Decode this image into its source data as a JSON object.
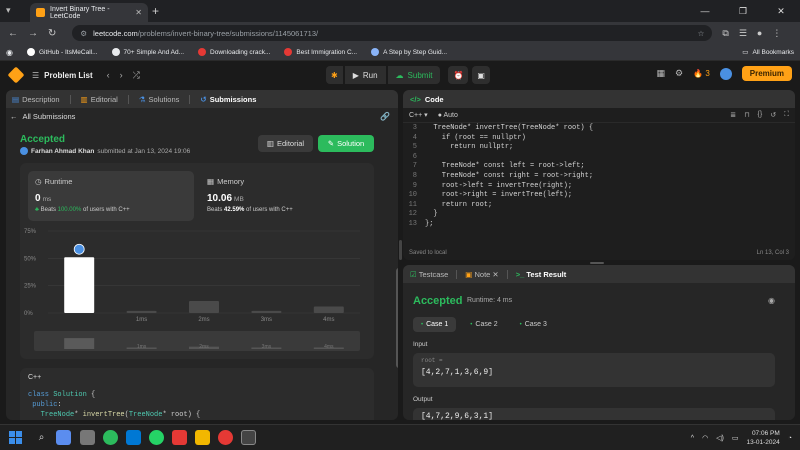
{
  "browser": {
    "tab_title": "Invert Binary Tree - LeetCode",
    "url_host": "leetcode.com",
    "url_path": "/problems/invert-binary-tree/submissions/1145061713/",
    "bookmarks": [
      {
        "label": "GitHub - ItsMeCall...",
        "color": "#ffffff"
      },
      {
        "label": "70+ Simple And Ad...",
        "color": "#e8eaed"
      },
      {
        "label": "Downloading crack...",
        "color": "#e53935"
      },
      {
        "label": "Best Immigration C...",
        "color": "#e53935"
      },
      {
        "label": "A Step by Step Guid...",
        "color": "#8ab4f8"
      }
    ],
    "all_bookmarks": "All Bookmarks"
  },
  "lc": {
    "problem_list": "Problem List",
    "run": "Run",
    "submit": "Submit",
    "streak": "3",
    "premium": "Premium"
  },
  "left": {
    "tabs": [
      "Description",
      "Editorial",
      "Solutions",
      "Submissions"
    ],
    "all_submissions": "All Submissions",
    "status": "Accepted",
    "user": "Farhan Ahmad Khan",
    "submitted_text": "submitted at Jan 13, 2024 19:06",
    "editorial_btn": "Editorial",
    "solution_btn": "Solution",
    "runtime": {
      "label": "Runtime",
      "value": "0",
      "unit": "ms",
      "beats_prefix": "Beats",
      "beats_pct": "100.00%",
      "beats_suffix": "of users with C++"
    },
    "memory": {
      "label": "Memory",
      "value": "10.06",
      "unit": "MB",
      "beats_prefix": "Beats",
      "beats_pct": "42.59%",
      "beats_suffix": "of users with C++"
    },
    "code_lang": "C++",
    "code_lines": [
      "class Solution {",
      " public:",
      "   TreeNode* invertTree(TreeNode* root) {"
    ]
  },
  "chart_data": {
    "type": "bar",
    "categories": [
      "0ms",
      "1ms",
      "2ms",
      "3ms",
      "4ms"
    ],
    "values": [
      51,
      2,
      11,
      2,
      6
    ],
    "yticks": [
      "75%",
      "50%",
      "25%",
      "0%"
    ],
    "ylim": [
      0,
      75
    ],
    "xlabels": [
      "1ms",
      "2ms",
      "3ms",
      "4ms"
    ],
    "highlight_index": 0,
    "colors": {
      "highlight": "#ffffff",
      "bar": "#4a4a4a"
    }
  },
  "code": {
    "title": "Code",
    "lang": "C++",
    "auto": "Auto",
    "lines": [
      {
        "n": "3",
        "t": "  TreeNode* invertTree(TreeNode* root) {"
      },
      {
        "n": "4",
        "t": "    if (root == nullptr)"
      },
      {
        "n": "5",
        "t": "      return nullptr;"
      },
      {
        "n": "6",
        "t": ""
      },
      {
        "n": "7",
        "t": "    TreeNode* const left = root->left;"
      },
      {
        "n": "8",
        "t": "    TreeNode* const right = root->right;"
      },
      {
        "n": "9",
        "t": "    root->left = invertTree(right);"
      },
      {
        "n": "10",
        "t": "    root->right = invertTree(left);"
      },
      {
        "n": "11",
        "t": "    return root;"
      },
      {
        "n": "12",
        "t": "  }"
      },
      {
        "n": "13",
        "t": "};"
      }
    ],
    "saved": "Saved to local",
    "cursor": "Ln 13, Col 3"
  },
  "result": {
    "tabs": [
      "Testcase",
      "Note",
      "Test Result"
    ],
    "status": "Accepted",
    "runtime": "Runtime: 4 ms",
    "cases": [
      "Case 1",
      "Case 2",
      "Case 3"
    ],
    "input_label": "Input",
    "input_var": "root =",
    "input_value": "[4,2,7,1,3,6,9]",
    "output_label": "Output",
    "output_value": "[4,7,2,9,6,3,1]"
  },
  "taskbar": {
    "time": "07:06 PM",
    "date": "13-01-2024",
    "lang": "ENG\nIN"
  }
}
